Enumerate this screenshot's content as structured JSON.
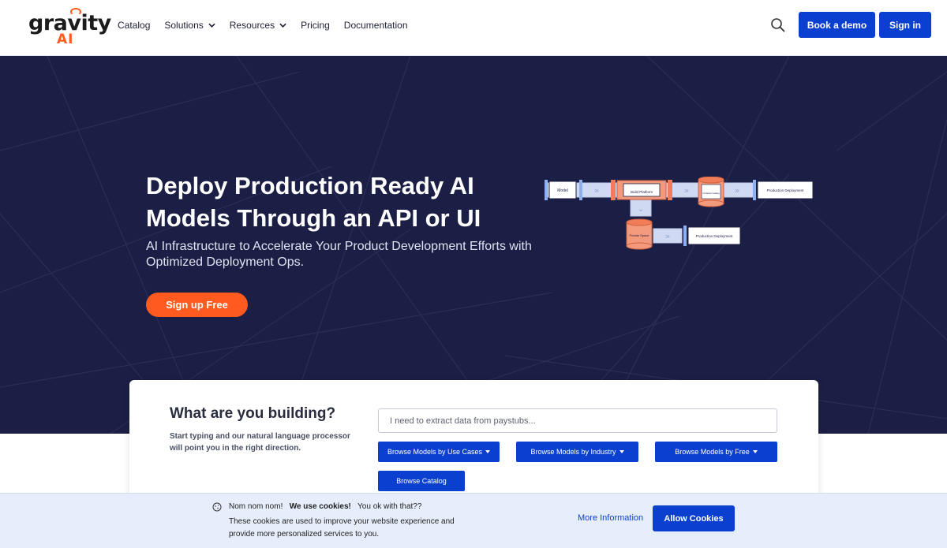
{
  "brand": {
    "logo_word": "gravity",
    "logo_suffix": "AI"
  },
  "nav": {
    "items": [
      {
        "label": "Catalog",
        "dropdown": false
      },
      {
        "label": "Solutions",
        "dropdown": true
      },
      {
        "label": "Resources",
        "dropdown": true
      },
      {
        "label": "Pricing",
        "dropdown": false
      },
      {
        "label": "Documentation",
        "dropdown": false
      }
    ],
    "book_demo": "Book a demo",
    "sign_in": "Sign in"
  },
  "hero": {
    "title": "Deploy Production Ready AI Models Through an API or UI",
    "subtitle": "AI Infrastructure to Accelerate Your Product Development Efforts with Optimized Deployment Ops.",
    "cta": "Sign up Free",
    "diagram": {
      "model": "Model",
      "build_platform": "Build Platform",
      "container_catalog": "Container Catalog",
      "production_deployment": "Production Deployment",
      "private_space": "Private Space",
      "production_deployment_2": "Production Deployment"
    }
  },
  "search_card": {
    "title": "What are you building?",
    "description": "Start typing and our natural language processor will point you in the right direction.",
    "input_value": "I need to extract data from paystubs...",
    "buttons": {
      "use_cases": "Browse Models by Use Cases",
      "industry": "Browse Models by Industry",
      "free": "Browse Models by Free",
      "catalog": "Browse Catalog"
    }
  },
  "cookie": {
    "intro": "Nom nom nom!",
    "strong": "We use cookies!",
    "question": "You ok with that??",
    "body": "These cookies are used to improve your website experience and provide more personalized services to you.",
    "more_info": "More Information",
    "allow": "Allow Cookies"
  },
  "colors": {
    "primary": "#0b3fd0",
    "accent": "#ff5a1f",
    "hero_bg": "#1c1f45",
    "cookie_bg": "#e7eefb"
  }
}
